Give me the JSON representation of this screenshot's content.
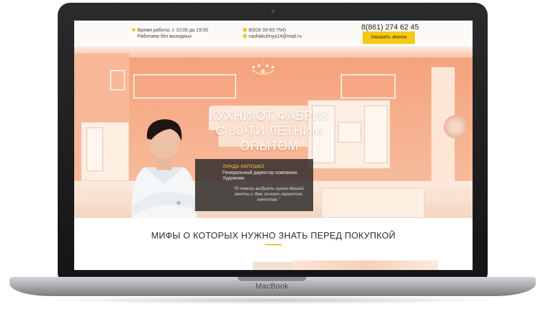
{
  "device": {
    "brand": "MacBook"
  },
  "header": {
    "hours_line1": "Время работы:  с 10:00 до 19:00",
    "hours_line2": "Работаем без выходных",
    "mobile": "8(918 33-93-754)",
    "email": "vashakuhnya14@mail.ru",
    "phone": "8(861) 274 62 45",
    "callback_button": "Заказать звонок"
  },
  "hero": {
    "title_line1": "КУХНИ ОТ ФАБРИК",
    "title_line2": "С 80-ТИ ЛЕТНИМ ОПЫТОМ"
  },
  "quote": {
    "name": "ЛИНДА ЛАПУШКО",
    "role": "Генеральный директор компании. Художник.",
    "text": "\"Я помогу выбрать кухню Вашей мечты и даю личную гарантию качества \""
  },
  "myths": {
    "title": "МИФЫ О КОТОРЫХ НУЖНО ЗНАТЬ ПЕРЕД ПОКУПКОЙ"
  },
  "colors": {
    "accent": "#f6c912",
    "hero": "#f4a079",
    "frame": "#1c1c1e"
  }
}
